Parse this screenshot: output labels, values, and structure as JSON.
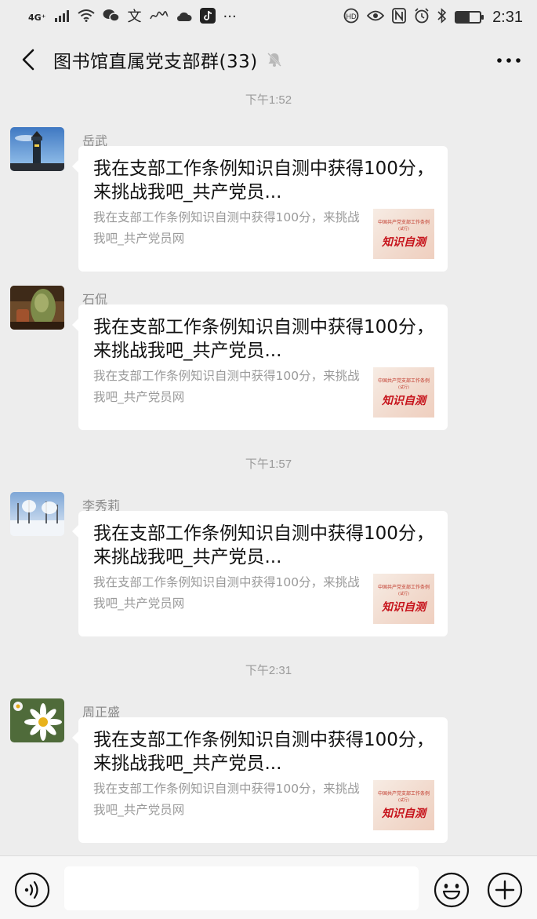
{
  "status_bar": {
    "network": "4G⁺",
    "time": "2:31",
    "battery_level": 0.55,
    "left_icons": [
      "signal-icon",
      "wifi-icon",
      "wechat-icon",
      "app-icon",
      "signature-icon",
      "cloud-icon",
      "tiktok-icon",
      "more-dots-icon"
    ],
    "right_icons": [
      "hd-call-icon",
      "eye-icon",
      "nfc-icon",
      "alarm-icon",
      "bluetooth-icon",
      "battery-icon"
    ]
  },
  "header": {
    "title": "图书馆直属党支部群(33)",
    "icons": [
      "back-icon",
      "mute-bell-icon",
      "more-icon"
    ]
  },
  "messages": [
    {
      "time": "下午1:52",
      "sender": "岳武",
      "avatar": "lighthouse",
      "title": "我在支部工作条例知识自测中获得100分，来挑战我吧_共产党员...",
      "desc": "我在支部工作条例知识自测中获得100分，来挑战我吧_共产党员网",
      "thumb": {
        "top": "中国共产党支部工作条例",
        "mid": "(试行)",
        "main": "知识自测"
      }
    },
    {
      "time": "",
      "sender": "石侃",
      "avatar": "sculpture",
      "title": "我在支部工作条例知识自测中获得100分，来挑战我吧_共产党员...",
      "desc": "我在支部工作条例知识自测中获得100分，来挑战我吧_共产党员网",
      "thumb": {
        "top": "中国共产党支部工作条例",
        "mid": "(试行)",
        "main": "知识自测"
      }
    },
    {
      "time": "下午1:57",
      "sender": "李秀莉",
      "avatar": "snow",
      "title": "我在支部工作条例知识自测中获得100分，来挑战我吧_共产党员...",
      "desc": "我在支部工作条例知识自测中获得100分，来挑战我吧_共产党员网",
      "thumb": {
        "top": "中国共产党支部工作条例",
        "mid": "(试行)",
        "main": "知识自测"
      }
    },
    {
      "time": "下午2:31",
      "sender": "周正盛",
      "avatar": "daisy",
      "title": "我在支部工作条例知识自测中获得100分，来挑战我吧_共产党员...",
      "desc": "我在支部工作条例知识自测中获得100分，来挑战我吧_共产党员网",
      "thumb": {
        "top": "中国共产党支部工作条例",
        "mid": "(试行)",
        "main": "知识自测"
      }
    }
  ],
  "input_bar": {
    "placeholder": "",
    "icons": [
      "voice-icon",
      "emoji-icon",
      "plus-icon"
    ]
  }
}
